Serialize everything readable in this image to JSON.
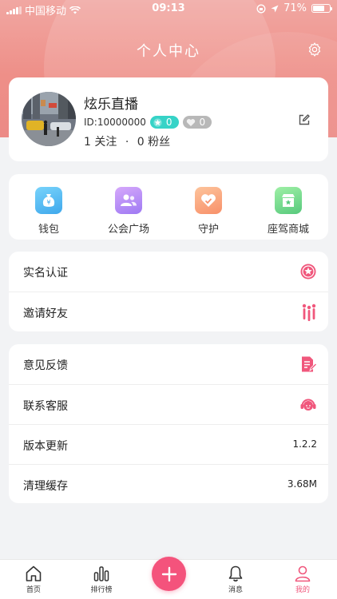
{
  "status_bar": {
    "carrier": "中国移动",
    "time": "09:13",
    "battery": "71%",
    "battery_level": 0.71
  },
  "header": {
    "title": "个人中心"
  },
  "profile": {
    "username": "炫乐直播",
    "id": "ID:10000000",
    "badge_star_count": "0",
    "badge_heart_count": "0",
    "follow_count": "1",
    "follow_label": "关注",
    "separator": "·",
    "fans_count": "0",
    "fans_label": "粉丝"
  },
  "actions": [
    {
      "label": "钱包",
      "icon": "wallet-icon",
      "color": "#4fb8f2"
    },
    {
      "label": "公会广场",
      "icon": "guild-icon",
      "color": "#b58af7"
    },
    {
      "label": "守护",
      "icon": "guard-heart-icon",
      "color": "#f9a77d"
    },
    {
      "label": "座驾商城",
      "icon": "mount-shop-icon",
      "color": "#6dd58a"
    }
  ],
  "list1": [
    {
      "label": "实名认证",
      "icon": "star-badge-icon"
    },
    {
      "label": "邀请好友",
      "icon": "invite-friends-icon"
    }
  ],
  "list2": [
    {
      "label": "意见反馈",
      "icon": "feedback-icon"
    },
    {
      "label": "联系客服",
      "icon": "customer-service-icon"
    },
    {
      "label": "版本更新",
      "value": "1.2.2"
    },
    {
      "label": "清理缓存",
      "value": "3.68M"
    }
  ],
  "tabbar": {
    "home": "首页",
    "ranking": "排行榜",
    "messages": "消息",
    "mine": "我的"
  },
  "colors": {
    "accent": "#f4537c",
    "header": "#ee8f88",
    "teal": "#36d3c7"
  }
}
